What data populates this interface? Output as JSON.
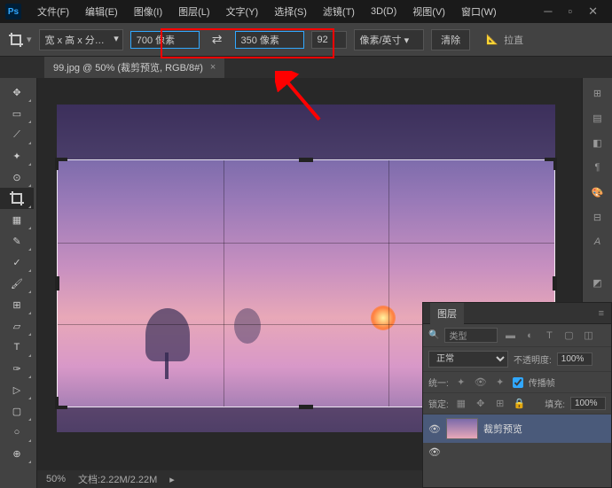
{
  "menubar": {
    "items": [
      "文件(F)",
      "编辑(E)",
      "图像(I)",
      "图层(L)",
      "文字(Y)",
      "选择(S)",
      "滤镜(T)",
      "3D(D)",
      "视图(V)",
      "窗口(W)"
    ]
  },
  "options": {
    "preset": "宽 x 高 x 分…",
    "width": "700 像素",
    "height": "350 像素",
    "resolution": "92",
    "unit": "像素/英寸",
    "clear": "清除",
    "straighten": "拉直"
  },
  "tab": {
    "title": "99.jpg @ 50% (裁剪预览, RGB/8#)"
  },
  "status": {
    "zoom": "50%",
    "doc": "文档:2.22M/2.22M"
  },
  "layers": {
    "title": "图层",
    "filter": "类型",
    "blend": "正常",
    "opacity_label": "不透明度:",
    "opacity": "100%",
    "unify_label": "统一:",
    "propagate": "传播帧",
    "lock_label": "锁定:",
    "fill_label": "填充:",
    "fill": "100%",
    "layer_name": "裁剪预览"
  }
}
